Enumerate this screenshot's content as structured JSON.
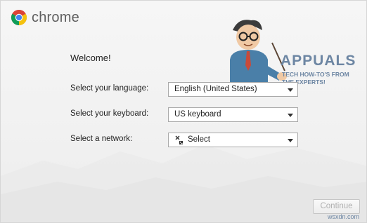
{
  "brand": {
    "name": "chrome",
    "colors": {
      "red": "#db4437",
      "yellow": "#f4c20d",
      "green": "#0f9d58",
      "blue": "#4285f4"
    }
  },
  "watermark": {
    "title": "APPUALS",
    "subtitle": "TECH HOW-TO'S FROM THE EXPERTS!",
    "color": "#6d86a3"
  },
  "welcome": {
    "title": "Welcome!"
  },
  "form": {
    "language": {
      "label": "Select your language:",
      "value": "English (United States)"
    },
    "keyboard": {
      "label": "Select your keyboard:",
      "value": "US keyboard"
    },
    "network": {
      "label": "Select a network:",
      "value": "Select",
      "icon": "network-disconnected-icon"
    }
  },
  "actions": {
    "continue_label": "Continue"
  },
  "footer": {
    "site": "wsxdn.com"
  }
}
